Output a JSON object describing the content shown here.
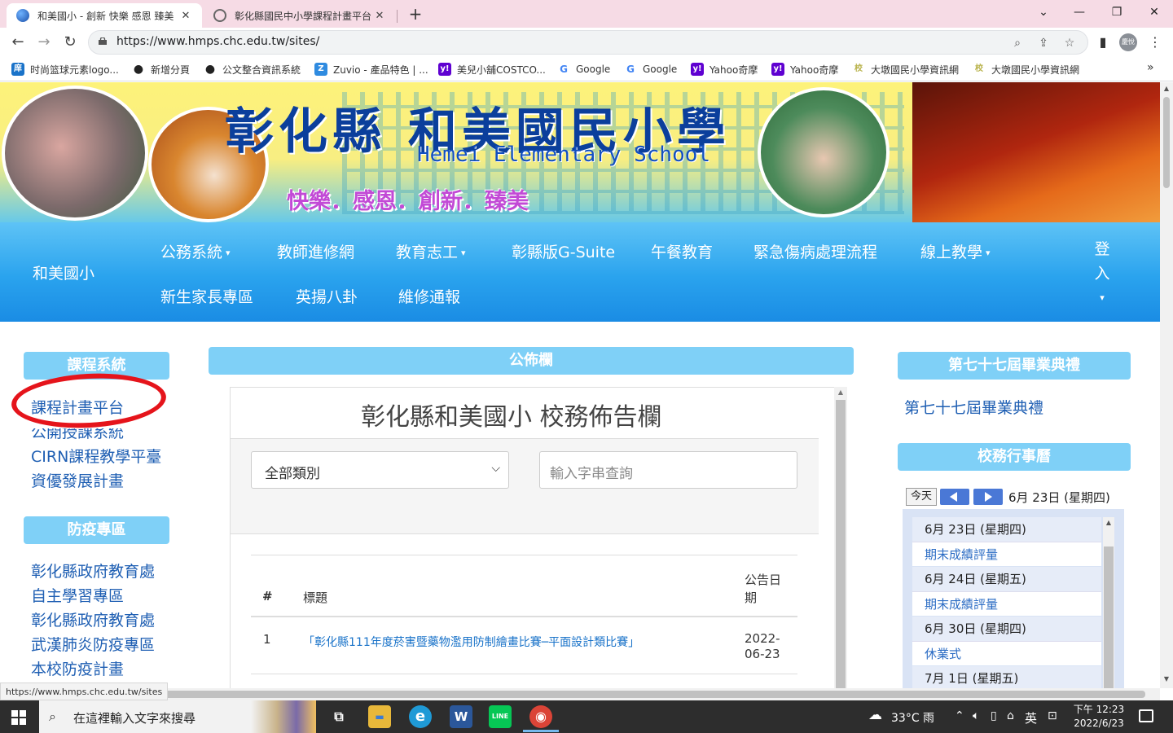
{
  "browser": {
    "tabs": [
      {
        "title": "和美國小 - 創新 快樂 感恩 臻美",
        "close": "✕"
      },
      {
        "title": "彰化縣國民中小學課程計畫平台",
        "close": "✕"
      }
    ],
    "new_tab": "+",
    "window_buttons": {
      "dropdown": "⌄",
      "minimize": "—",
      "restore": "❐",
      "close": "✕"
    },
    "url": "https://www.hmps.chc.edu.tw/sites/",
    "nav": {
      "back": "←",
      "forward": "→",
      "reload": "↻"
    },
    "profile_label": "慶悅",
    "bookmarks": [
      {
        "label": "时尚篮球元素logo...",
        "icon": "庠",
        "color": "#1a73c9"
      },
      {
        "label": "新增分頁",
        "icon": "●",
        "color": "#222"
      },
      {
        "label": "公文整合資訊系統",
        "icon": "●",
        "color": "#222"
      },
      {
        "label": "Zuvio - 產品特色 | ...",
        "icon": "Z",
        "color": "#2f8be0"
      },
      {
        "label": "美兒小舖COSTCO...",
        "icon": "y!",
        "color": "#5f01d1"
      },
      {
        "label": "Google",
        "icon": "G",
        "color": "#4285f4"
      },
      {
        "label": "Google",
        "icon": "G",
        "color": "#4285f4"
      },
      {
        "label": "Yahoo奇摩",
        "icon": "y!",
        "color": "#5f01d1"
      },
      {
        "label": "Yahoo奇摩",
        "icon": "y!",
        "color": "#5f01d1"
      },
      {
        "label": "大墩國民小學資訊網",
        "icon": "校",
        "color": "#b8b24a"
      },
      {
        "label": "大墩國民小學資訊網",
        "icon": "校",
        "color": "#b8b24a"
      }
    ],
    "bookmarks_more": "»",
    "status_url": "https://www.hmps.chc.edu.tw/sites"
  },
  "banner": {
    "title": "彰化縣 和美國民小學",
    "english": "Hemei Elementary School",
    "motto": "快樂．感恩．創新．臻美"
  },
  "navbar": {
    "brand": "和美國小",
    "items": [
      "公務系統",
      "教師進修網",
      "教育志工",
      "彰縣版G-Suite",
      "午餐教育",
      "緊急傷病處理流程",
      "線上教學",
      "新生家長專區",
      "英揚八卦",
      "維修通報"
    ],
    "login": [
      "登",
      "入"
    ],
    "caret": "▾"
  },
  "left_sidebar": {
    "sections": [
      {
        "heading": "課程系統",
        "links": [
          "課程計畫平台",
          "公開授課系統",
          "CIRN課程教學平臺",
          "資優發展計畫"
        ]
      },
      {
        "heading": "防疫專區",
        "links": [
          "彰化縣政府教育處",
          "自主學習專區",
          "彰化縣政府教育處",
          "武漢肺炎防疫專區",
          "本校防疫計畫"
        ]
      }
    ]
  },
  "bulletin": {
    "heading": "公佈欄",
    "title": "彰化縣和美國小 校務佈告欄",
    "category_select": "全部類別",
    "search_placeholder": "輸入字串查詢",
    "columns": {
      "num": "#",
      "title": "標題",
      "date": "公告日期"
    },
    "rows": [
      {
        "num": "1",
        "title": "「彰化縣111年度菸害暨藥物濫用防制繪畫比賽─平面設計類比賽」",
        "date": "2022-06-23"
      }
    ]
  },
  "right_sidebar": {
    "graduation": {
      "heading": "第七十七屆畢業典禮",
      "link": "第七十七屆畢業典禮"
    },
    "calendar": {
      "heading": "校務行事曆",
      "today_button": "今天",
      "current_date": "6月 23日 (星期四)",
      "entries": [
        {
          "type": "day",
          "text": "6月 23日 (星期四)"
        },
        {
          "type": "event",
          "text": "期末成績評量"
        },
        {
          "type": "day",
          "text": "6月 24日 (星期五)"
        },
        {
          "type": "event",
          "text": "期末成績評量"
        },
        {
          "type": "day",
          "text": "6月 30日 (星期四)"
        },
        {
          "type": "event",
          "text": "休業式"
        },
        {
          "type": "day",
          "text": "7月 1日 (星期五)"
        }
      ]
    }
  },
  "taskbar": {
    "search_text": "在這裡輸入文字來搜尋",
    "apps": [
      {
        "name": "task-view",
        "label": "⧉",
        "color": "#2d2d2d"
      },
      {
        "name": "file-explorer",
        "label": "▬",
        "color": "#e8b83a"
      },
      {
        "name": "edge",
        "label": "e",
        "color": "#1f9ad6"
      },
      {
        "name": "word",
        "label": "W",
        "color": "#2b579a"
      },
      {
        "name": "line",
        "label": "LINE",
        "color": "#06c755"
      },
      {
        "name": "chrome",
        "label": "◉",
        "color": "#db4437"
      }
    ],
    "weather": "33°C 雨",
    "ime": "英",
    "time": "下午 12:23",
    "date": "2022/6/23"
  }
}
